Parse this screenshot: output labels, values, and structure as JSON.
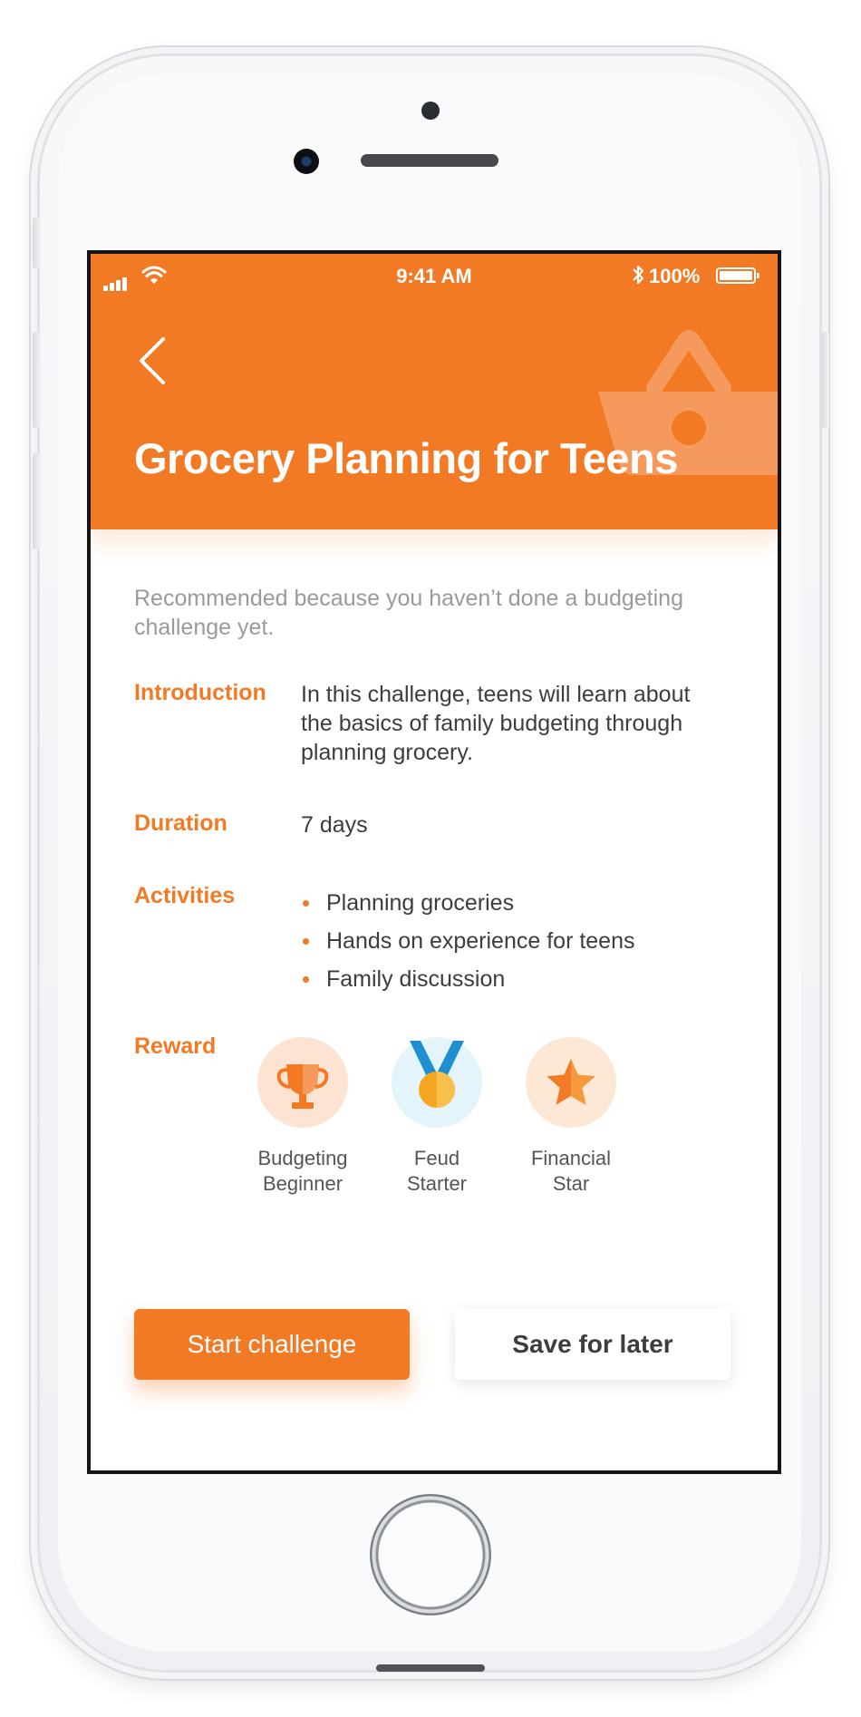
{
  "status_bar": {
    "time": "9:41 AM",
    "battery": "100%"
  },
  "header": {
    "title": "Grocery Planning for Teens",
    "background_color": "#f37a24",
    "back_icon": "chevron-left-icon",
    "decoration_icon": "basket-icon"
  },
  "recommendation": "Recommended because you haven’t done a budgeting challenge yet.",
  "details": {
    "introduction": {
      "label": "Introduction",
      "text": "In this challenge, teens will learn about the basics of family budgeting through planning grocery."
    },
    "duration": {
      "label": "Duration",
      "text": "7 days"
    },
    "activities": {
      "label": "Activities",
      "items": [
        "Planning groceries",
        "Hands on experience for teens",
        "Family discussion"
      ]
    },
    "reward": {
      "label": "Reward",
      "items": [
        {
          "line1": "Budgeting",
          "line2": "Beginner",
          "icon": "trophy-icon"
        },
        {
          "line1": "Feud",
          "line2": "Starter",
          "icon": "medal-icon"
        },
        {
          "line1": "Financial",
          "line2": "Star",
          "icon": "star-icon"
        }
      ]
    }
  },
  "actions": {
    "primary": "Start challenge",
    "secondary": "Save for later"
  },
  "colors": {
    "accent": "#f37a24",
    "text": "#3d3d3d",
    "muted": "#9a9a9a"
  }
}
